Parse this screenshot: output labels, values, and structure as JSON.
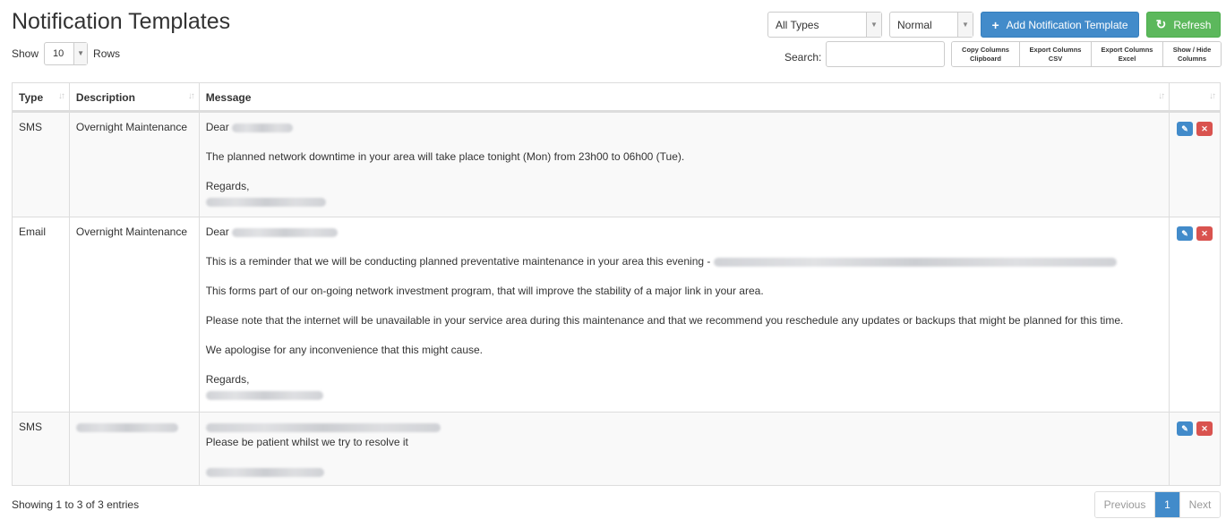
{
  "page": {
    "title": "Notification Templates"
  },
  "rows_control": {
    "show_label": "Show",
    "value": "10",
    "rows_label": "Rows"
  },
  "filters": {
    "type_value": "All Types",
    "priority_value": "Normal"
  },
  "buttons": {
    "add_label": "Add Notification Template",
    "add_icon": "plus-icon",
    "refresh_label": "Refresh",
    "refresh_icon": "refresh-icon"
  },
  "search": {
    "label": "Search:",
    "value": ""
  },
  "tools": [
    {
      "line1": "Copy Columns",
      "line2": "Clipboard"
    },
    {
      "line1": "Export Columns",
      "line2": "CSV"
    },
    {
      "line1": "Export Columns",
      "line2": "Excel"
    },
    {
      "line1": "Show / Hide",
      "line2": "Columns"
    }
  ],
  "table": {
    "headers": {
      "type": "Type",
      "description": "Description",
      "message": "Message",
      "actions": ""
    },
    "rows": [
      {
        "type": "SMS",
        "description": "Overnight Maintenance",
        "lines": {
          "greeting": "Dear",
          "body1": "The planned network downtime in your area will take place tonight (Mon) from 23h00 to 06h00 (Tue).",
          "sign": "Regards,"
        }
      },
      {
        "type": "Email",
        "description": "Overnight Maintenance",
        "lines": {
          "greeting": "Dear",
          "body1": "This is a reminder that we will be conducting planned preventative maintenance in your area this evening -",
          "body2": "This forms part of our on-going network investment program, that will improve the stability of a major link in your area.",
          "body3": "Please note that the internet will be unavailable in your service area during this maintenance and that we recommend you reschedule any updates or backups that might be planned for this time.",
          "body4": "We apologise for any inconvenience that this might cause.",
          "sign": "Regards,"
        }
      },
      {
        "type": "SMS",
        "description": "",
        "lines": {
          "body1": "Please be patient whilst we try to resolve it"
        }
      }
    ],
    "row_actions": {
      "edit_icon": "edit-icon",
      "delete_icon": "delete-icon"
    }
  },
  "footer": {
    "info": "Showing 1 to 3 of 3 entries",
    "pagination": {
      "previous": "Previous",
      "current": "1",
      "next": "Next"
    }
  },
  "colors": {
    "primary": "#428bca",
    "success": "#5cb85c",
    "danger": "#d9534f"
  }
}
